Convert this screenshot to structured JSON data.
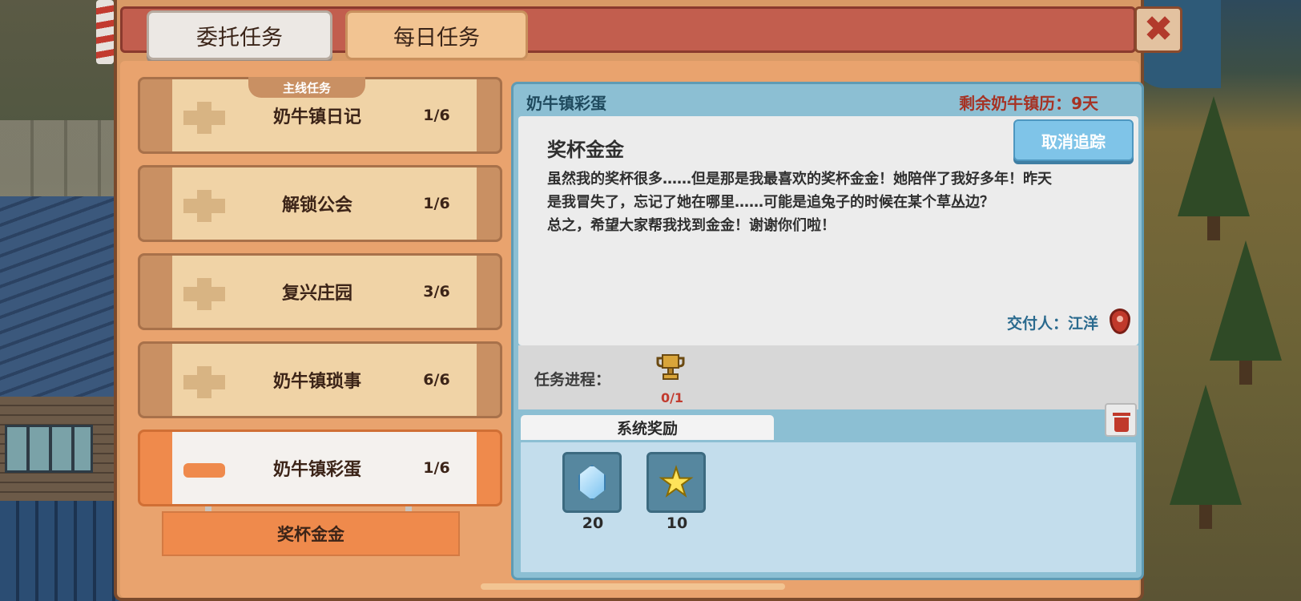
{
  "tabs": {
    "commission": "委托任务",
    "daily": "每日任务"
  },
  "close_button": "✖",
  "quest_list": {
    "category_tag": "主线任务",
    "items": [
      {
        "name": "奶牛镇日记",
        "progress": "1/6"
      },
      {
        "name": "解锁公会",
        "progress": "1/6"
      },
      {
        "name": "复兴庄园",
        "progress": "3/6"
      },
      {
        "name": "奶牛镇琐事",
        "progress": "6/6"
      },
      {
        "name": "奶牛镇彩蛋",
        "progress": "1/6"
      }
    ],
    "active_subquest": "奖杯金金"
  },
  "detail": {
    "quest_line": "奶牛镇彩蛋",
    "days_remaining": "剩余奶牛镇历：9天",
    "track_button": "取消追踪",
    "quest_title": "奖杯金金",
    "description_lines": [
      "虽然我的奖杯很多……但是那是我最喜欢的奖杯金金！她陪伴了我好多年！昨天",
      "是我冒失了，忘记了她在哪里……可能是追兔子的时候在某个草丛边？",
      "总之，希望大家帮我找到金金！谢谢你们啦！"
    ],
    "giver": "交付人：江洋",
    "progress_label": "任务进程：",
    "progress_count": "0/1",
    "reward_tab": "系统奖励",
    "rewards": [
      {
        "icon": "diamond-icon",
        "quantity": "20"
      },
      {
        "icon": "star-icon",
        "quantity": "10"
      }
    ]
  },
  "colors": {
    "header_red": "#c25e4e",
    "panel_orange": "#e9a36e",
    "active_orange": "#ef8a4c",
    "detail_blue": "#8cbfd3",
    "accent_red_text": "#a63224"
  }
}
